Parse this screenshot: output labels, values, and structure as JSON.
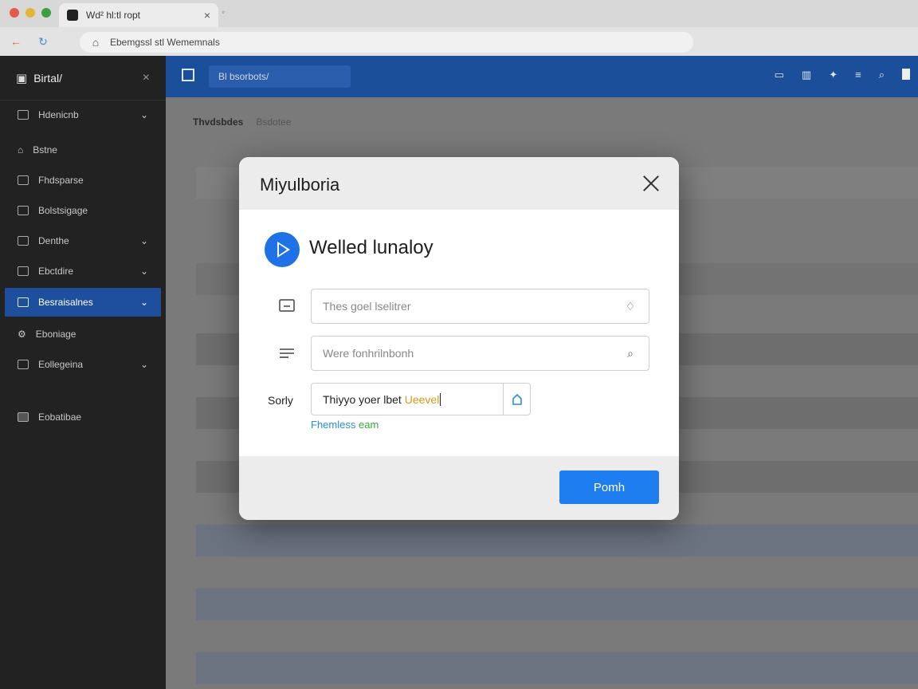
{
  "browser": {
    "tab_title": "Wd² hl:tl ropt",
    "url": "Ebemgssl stl Wememnals",
    "colors": {
      "close": "#e55a4f",
      "minimize": "#e3b43a",
      "maximize": "#38a13f"
    }
  },
  "sidebar": {
    "brand": "Birtal/",
    "items": [
      {
        "label": "Hdenicnb",
        "icon": "grid-icon",
        "has_chevron": true
      },
      {
        "label": "Bstne",
        "icon": "home-icon",
        "has_chevron": false
      },
      {
        "label": "Fhdsparse",
        "icon": "table-icon",
        "has_chevron": false
      },
      {
        "label": "Bolstsigage",
        "icon": "table-icon",
        "has_chevron": false
      },
      {
        "label": "Denthe",
        "icon": "folder-icon",
        "has_chevron": true
      },
      {
        "label": "Ebctdire",
        "icon": "network-icon",
        "has_chevron": true
      },
      {
        "label": "Besraisalnes",
        "icon": "grid-icon",
        "has_chevron": true,
        "active": true
      },
      {
        "label": "Eboniage",
        "icon": "gear-icon",
        "has_chevron": false
      },
      {
        "label": "Eollegeina",
        "icon": "lock-icon",
        "has_chevron": true
      },
      {
        "label": "Eobatibae",
        "icon": "square-icon",
        "has_chevron": false
      }
    ]
  },
  "topbar": {
    "search_text": "Bl bsorbots/",
    "icons": [
      "monitor-icon",
      "chart-icon",
      "pin-icon",
      "menu-icon",
      "search-icon"
    ]
  },
  "content": {
    "breadcrumb": "Thvdsbdes",
    "breadcrumb_sub": "Bsdotee"
  },
  "modal": {
    "title": "Miyulboria",
    "section_title": "Welled lunaloy",
    "field1": {
      "value": "",
      "placeholder": "Thes goel lselitrer"
    },
    "field2": {
      "value": "",
      "placeholder": "Were fonhrilnbonh"
    },
    "field3": {
      "label": "Sorly",
      "value_main": "Thiyyo yoer lbet",
      "value_highlight": "Ueevel"
    },
    "helper": {
      "blue": "Fhemless",
      "green": "eam"
    },
    "primary_button": "Pomh"
  },
  "theme": {
    "accent": "#1e7ef0",
    "topbar": "#1c4f9a",
    "sidebar": "#222222",
    "active": "#1e4f9c"
  }
}
